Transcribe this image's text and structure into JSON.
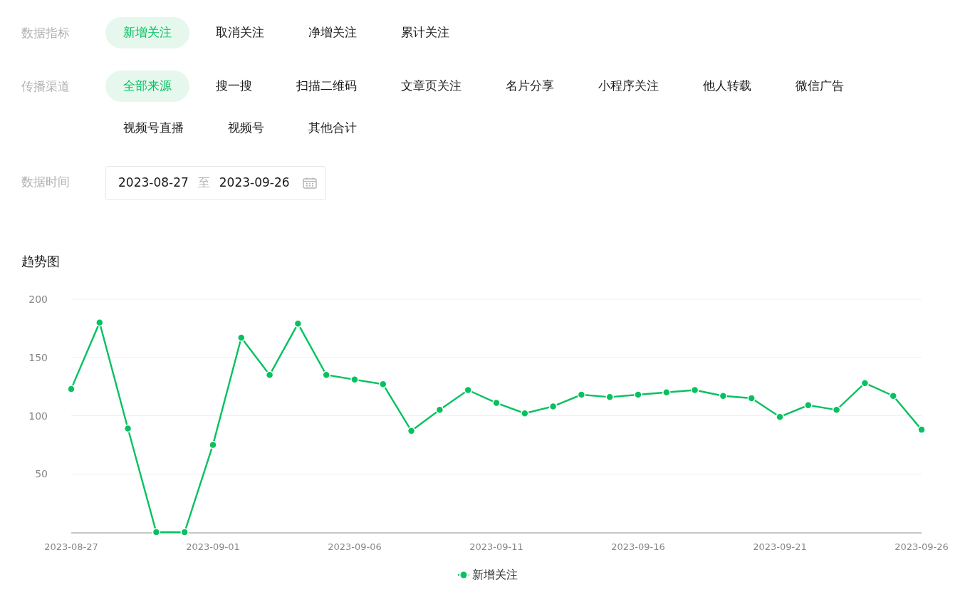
{
  "filters": [
    {
      "label": "数据指标",
      "options": [
        {
          "text": "新增关注",
          "selected": true
        },
        {
          "text": "取消关注",
          "selected": false
        },
        {
          "text": "净增关注",
          "selected": false
        },
        {
          "text": "累计关注",
          "selected": false
        }
      ]
    },
    {
      "label": "传播渠道",
      "options": [
        {
          "text": "全部来源",
          "selected": true
        },
        {
          "text": "搜一搜",
          "selected": false
        },
        {
          "text": "扫描二维码",
          "selected": false
        },
        {
          "text": "文章页关注",
          "selected": false
        },
        {
          "text": "名片分享",
          "selected": false
        },
        {
          "text": "小程序关注",
          "selected": false
        },
        {
          "text": "他人转载",
          "selected": false
        },
        {
          "text": "微信广告",
          "selected": false
        },
        {
          "text": "视频号直播",
          "selected": false
        },
        {
          "text": "视频号",
          "selected": false
        },
        {
          "text": "其他合计",
          "selected": false
        }
      ]
    }
  ],
  "date_range": {
    "label": "数据时间",
    "start": "2023-08-27",
    "separator": "至",
    "end": "2023-09-26"
  },
  "trend": {
    "title": "趋势图",
    "chart_data": {
      "type": "line",
      "x": [
        "2023-08-27",
        "2023-08-28",
        "2023-08-29",
        "2023-08-30",
        "2023-08-31",
        "2023-09-01",
        "2023-09-02",
        "2023-09-03",
        "2023-09-04",
        "2023-09-05",
        "2023-09-06",
        "2023-09-07",
        "2023-09-08",
        "2023-09-09",
        "2023-09-10",
        "2023-09-11",
        "2023-09-12",
        "2023-09-13",
        "2023-09-14",
        "2023-09-15",
        "2023-09-16",
        "2023-09-17",
        "2023-09-18",
        "2023-09-19",
        "2023-09-20",
        "2023-09-21",
        "2023-09-22",
        "2023-09-23",
        "2023-09-24",
        "2023-09-25",
        "2023-09-26"
      ],
      "series": [
        {
          "name": "新增关注",
          "color": "#07c160",
          "marker": "circle",
          "values": [
            123,
            180,
            89,
            0,
            0,
            75,
            167,
            135,
            179,
            135,
            131,
            127,
            87,
            105,
            122,
            111,
            102,
            108,
            118,
            116,
            118,
            120,
            122,
            117,
            115,
            99,
            109,
            105,
            128,
            117,
            88
          ]
        }
      ],
      "grid": true,
      "xlim": [
        "2023-08-27",
        "2023-09-26"
      ],
      "ylim": [
        0,
        200
      ],
      "yticks": [
        50,
        100,
        150,
        200
      ],
      "xticks": [
        "2023-08-27",
        "2023-09-01",
        "2023-09-06",
        "2023-09-11",
        "2023-09-16",
        "2023-09-21",
        "2023-09-26"
      ]
    }
  }
}
